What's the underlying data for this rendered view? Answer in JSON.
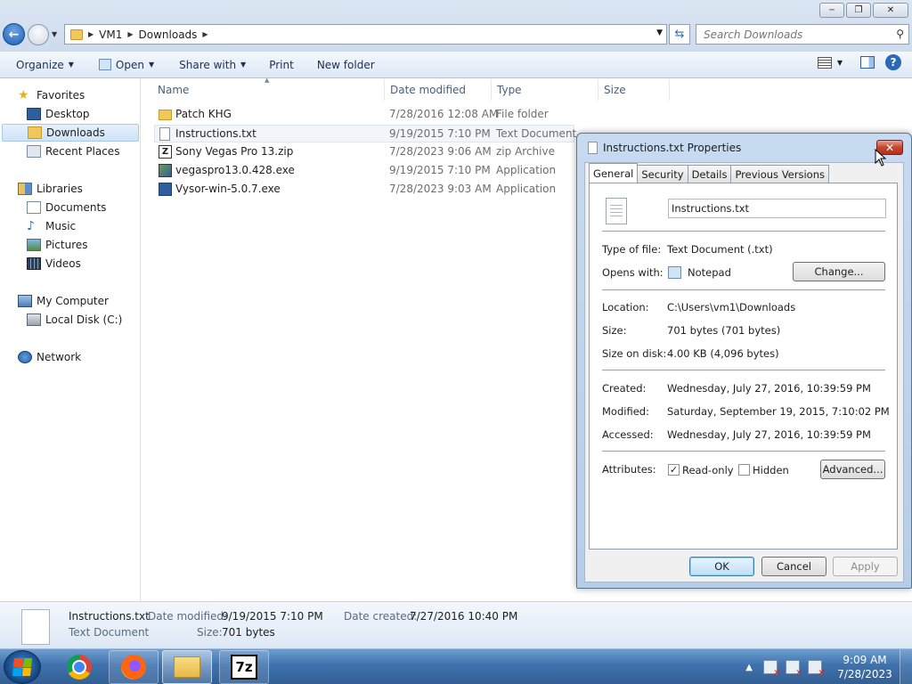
{
  "window": {
    "minimize": "─",
    "maximize": "❐",
    "close": "✕"
  },
  "nav": {
    "breadcrumb": [
      "VM1",
      "Downloads"
    ],
    "search_placeholder": "Search Downloads"
  },
  "toolbar": {
    "organize": "Organize",
    "open": "Open",
    "share_with": "Share with",
    "print": "Print",
    "new_folder": "New folder"
  },
  "sidebar": {
    "favorites": "Favorites",
    "desktop": "Desktop",
    "downloads": "Downloads",
    "recent_places": "Recent Places",
    "libraries": "Libraries",
    "documents": "Documents",
    "music": "Music",
    "pictures": "Pictures",
    "videos": "Videos",
    "my_computer": "My Computer",
    "local_disk": "Local Disk (C:)",
    "network": "Network"
  },
  "columns": {
    "name": "Name",
    "date_modified": "Date modified",
    "type": "Type",
    "size": "Size"
  },
  "files": [
    {
      "name": "Patch KHG",
      "date": "7/28/2016 12:08 AM",
      "type": "File folder"
    },
    {
      "name": "Instructions.txt",
      "date": "9/19/2015 7:10 PM",
      "type": "Text Document"
    },
    {
      "name": "Sony Vegas Pro 13.zip",
      "date": "7/28/2023 9:06 AM",
      "type": "zip Archive"
    },
    {
      "name": "vegaspro13.0.428.exe",
      "date": "9/19/2015 7:10 PM",
      "type": "Application"
    },
    {
      "name": "Vysor-win-5.0.7.exe",
      "date": "7/28/2023 9:03 AM",
      "type": "Application"
    }
  ],
  "details": {
    "name": "Instructions.txt",
    "type": "Text Document",
    "date_modified_label": "Date modified:",
    "date_modified": "9/19/2015 7:10 PM",
    "date_created_label": "Date created:",
    "date_created": "7/27/2016 10:40 PM",
    "size_label": "Size:",
    "size": "701 bytes"
  },
  "dialog": {
    "title": "Instructions.txt Properties",
    "tabs": [
      "General",
      "Security",
      "Details",
      "Previous Versions"
    ],
    "file_name": "Instructions.txt",
    "type_label": "Type of file:",
    "type_value": "Text Document (.txt)",
    "opens_label": "Opens with:",
    "opens_value": "Notepad",
    "change": "Change...",
    "location_label": "Location:",
    "location_value": "C:\\Users\\vm1\\Downloads",
    "size_label": "Size:",
    "size_value": "701 bytes (701 bytes)",
    "disk_label": "Size on disk:",
    "disk_value": "4.00 KB (4,096 bytes)",
    "created_label": "Created:",
    "created_value": "Wednesday, July 27, 2016, 10:39:59 PM",
    "modified_label": "Modified:",
    "modified_value": "Saturday, September 19, 2015, 7:10:02 PM",
    "accessed_label": "Accessed:",
    "accessed_value": "Wednesday, July 27, 2016, 10:39:59 PM",
    "attributes_label": "Attributes:",
    "readonly": "Read-only",
    "hidden": "Hidden",
    "advanced": "Advanced...",
    "ok": "OK",
    "cancel": "Cancel",
    "apply": "Apply"
  },
  "taskbar": {
    "time": "9:09 AM",
    "date": "7/28/2023",
    "sevenzip": "7z"
  }
}
